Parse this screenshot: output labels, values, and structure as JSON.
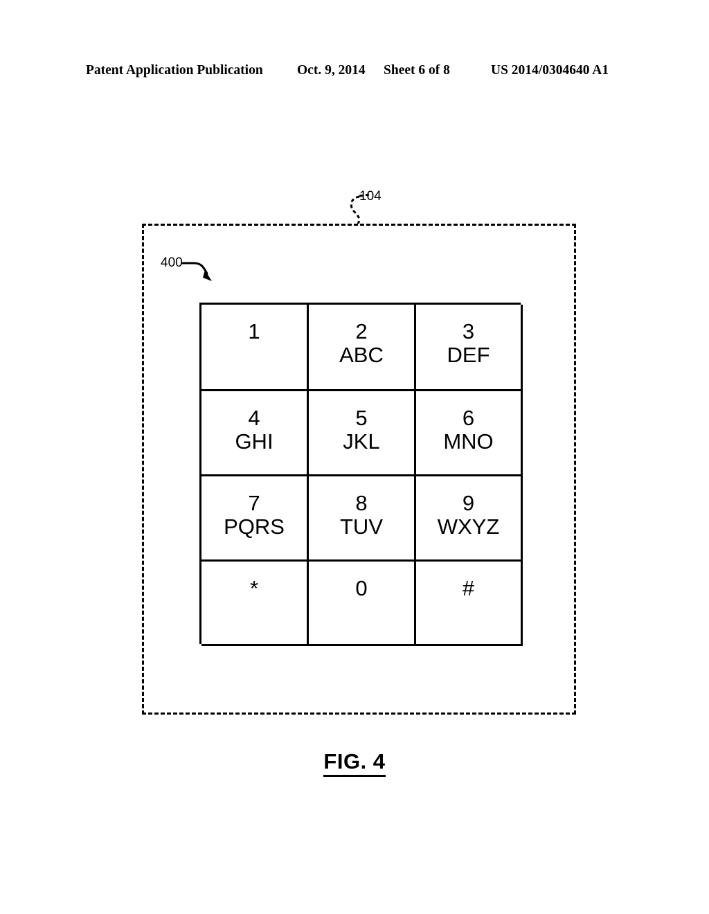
{
  "header": {
    "publication": "Patent Application Publication",
    "date": "Oct. 9, 2014",
    "sheet": "Sheet 6 of 8",
    "patent_number": "US 2014/0304640 A1"
  },
  "figure": {
    "caption": "FIG. 4",
    "device_ref": "104",
    "keypad_ref": "400"
  },
  "keypad": {
    "keys": [
      {
        "digit": "1",
        "letters": ""
      },
      {
        "digit": "2",
        "letters": "ABC"
      },
      {
        "digit": "3",
        "letters": "DEF"
      },
      {
        "digit": "4",
        "letters": "GHI"
      },
      {
        "digit": "5",
        "letters": "JKL"
      },
      {
        "digit": "6",
        "letters": "MNO"
      },
      {
        "digit": "7",
        "letters": "PQRS"
      },
      {
        "digit": "8",
        "letters": "TUV"
      },
      {
        "digit": "9",
        "letters": "WXYZ"
      },
      {
        "digit": "*",
        "letters": ""
      },
      {
        "digit": "0",
        "letters": ""
      },
      {
        "digit": "#",
        "letters": ""
      }
    ]
  },
  "colors": {
    "ink": "#000000",
    "paper": "#ffffff"
  }
}
